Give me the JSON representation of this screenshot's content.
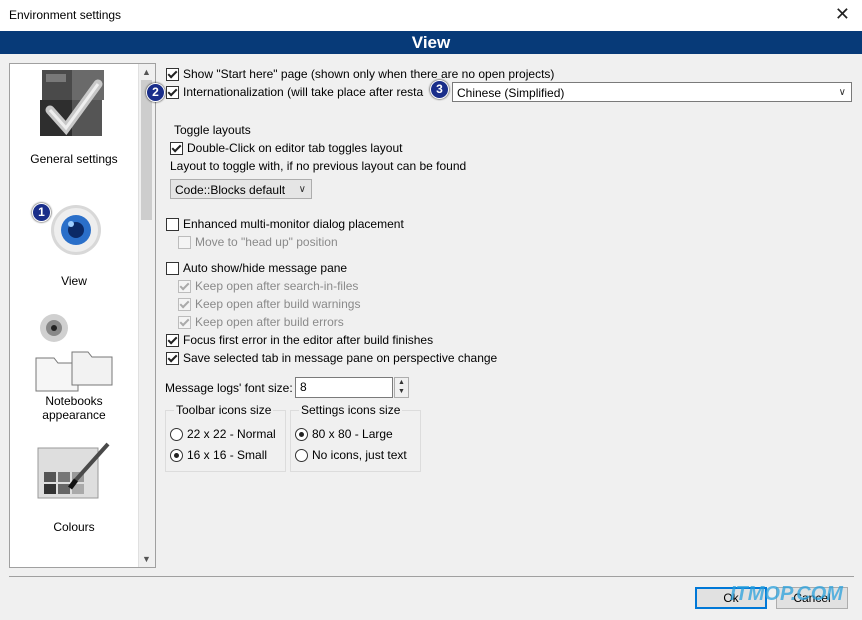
{
  "window": {
    "title": "Environment settings"
  },
  "banner": {
    "title": "View"
  },
  "sidebar": {
    "items": [
      {
        "label": "General settings"
      },
      {
        "label": "View"
      },
      {
        "label": "Notebooks appearance"
      },
      {
        "label": "Colours"
      }
    ]
  },
  "badges": [
    "1",
    "2",
    "3"
  ],
  "options": {
    "show_start_here": "Show \"Start here\" page (shown only when there are no open projects)",
    "internationalization": "Internationalization (will take place after resta",
    "language_value": "Chinese (Simplified)",
    "toggle_layouts_title": "Toggle layouts",
    "double_click_toggle": "Double-Click on editor tab toggles layout",
    "layout_to_toggle_label": "Layout to toggle with, if no previous layout can be found",
    "layout_value": "Code::Blocks default",
    "enhanced_multimonitor": "Enhanced multi-monitor dialog placement",
    "move_head_up": "Move to \"head up\" position",
    "auto_show_hide": "Auto show/hide message pane",
    "keep_open_search": "Keep open after search-in-files",
    "keep_open_warnings": "Keep open after build warnings",
    "keep_open_errors": "Keep open after build errors",
    "focus_first_error": "Focus first error in the editor after build finishes",
    "save_selected_tab": "Save selected tab in message pane on perspective change",
    "font_size_label": "Message logs' font size:",
    "font_size_value": "8",
    "toolbar_icons_title": "Toolbar icons size",
    "toolbar_opt1": "22 x 22 - Normal",
    "toolbar_opt2": "16 x 16 - Small",
    "settings_icons_title": "Settings icons size",
    "settings_opt1": "80 x 80 - Large",
    "settings_opt2": "No icons, just text"
  },
  "footer": {
    "ok": "Ok",
    "cancel": "Cancel"
  },
  "watermark": "ITMOP.COM"
}
